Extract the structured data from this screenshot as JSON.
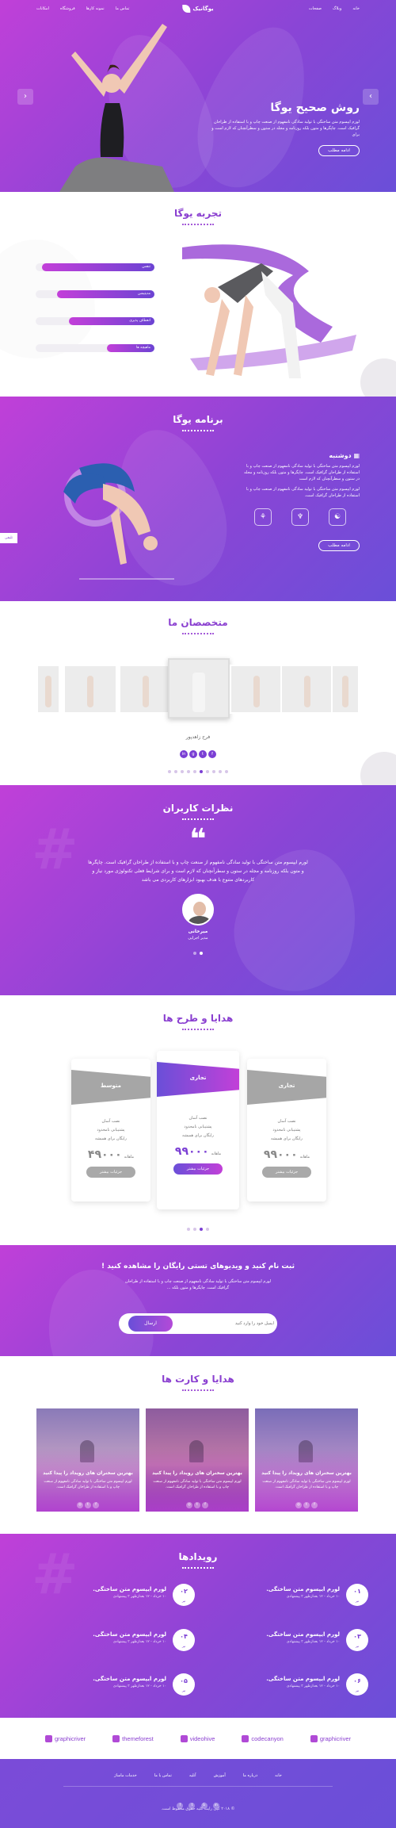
{
  "nav": {
    "brand": "یوگانیک",
    "right_menu": [
      "خانه",
      "وبلاگ",
      "صفحات"
    ],
    "left_menu": [
      "تماس ما",
      "نمونه کارها",
      "فروشگاه",
      "امکانات"
    ]
  },
  "hero": {
    "title": "روش صحیح یوگا",
    "text": "لورم ایپسوم متن ساختگی با تولید سادگی نامفهوم از صنعت چاپ و با استفاده از طراحان گرافیک است. چاپگرها و متون بلکه روزنامه و مجله در ستون و سطرآنچنان که لازم است و برای",
    "button": "ادامه مطلب"
  },
  "experience": {
    "title": "تجربه یوگا",
    "skills": [
      {
        "label": "تنفس",
        "percent": 95
      },
      {
        "label": "مدیتیشن",
        "percent": 82
      },
      {
        "label": "انعطاف پذیری",
        "percent": 72
      },
      {
        "label": "ماهیچه ها",
        "percent": 40
      }
    ]
  },
  "program": {
    "title": "برنامه یوگا",
    "day": "دوشنبه",
    "text1": "لورم ایپسوم متن ساختگی با تولید سادگی نامفهوم از صنعت چاپ و با استفاده از طراحان گرافیک است. چاپگرها و متون بلکه روزنامه و مجله در ستون و سطرآنچنان که لازم است",
    "text2": "لورم ایپسوم متن ساختگی با تولید سادگی نامفهوم از صنعت چاپ و با استفاده از طراحان گرافیک است.",
    "button": "ادامه مطلب",
    "side_tab": "تلیفی"
  },
  "experts": {
    "title": "متخصصان ما",
    "name": "فرح زاهدپور",
    "social": [
      "f",
      "t",
      "g",
      "in"
    ],
    "pages": 10
  },
  "testimonial": {
    "title": "نظرات کاربران",
    "quote": "لورم ایپسوم متن ساختگی با تولید سادگی نامفهوم از صنعت چاپ و با استفاده از طراحان گرافیک است. چاپگرها و متون بلکه روزنامه و مجله در ستون و سطرآنچنان که لازم است و برای شرایط فعلی تکنولوژی مورد نیاز و کاربردهای متنوع با هدف بهبود ابزارهای کاربردی می باشد",
    "name": "میرخانی",
    "role": "مدیر اجرایی"
  },
  "pricing": {
    "title": "هدایا و طرح ها",
    "cards": [
      {
        "name": "تجاری",
        "features": [
          "نصب آسان",
          "پشتیبانی نامحدود",
          "رایگان برای همیشه"
        ],
        "price": "۹۹۰۰۰",
        "unit": "ماهانه",
        "button": "جزئیات بیشتر"
      },
      {
        "name": "تجاری",
        "features": [
          "نصب آسان",
          "پشتیبانی نامحدود",
          "رایگان برای همیشه"
        ],
        "price": "۹۹۰۰۰",
        "unit": "ماهانه",
        "button": "جزئیات بیشتر"
      },
      {
        "name": "متوسط",
        "features": [
          "نصب آسان",
          "پشتیبانی نامحدود",
          "رایگان برای همیشه"
        ],
        "price": "۴۹۰۰۰",
        "unit": "ماهانه",
        "button": "جزئیات بیشتر"
      }
    ],
    "pages": 4
  },
  "subscribe": {
    "title": "ثبت نام کنید و ویدیوهای تستی رایگان را مشاهده کنید !",
    "text": "لورم ایپسوم متن ساختگی با تولید سادگی نامفهوم از صنعت چاپ و با استفاده از طراحان گرافیک است. چاپگرها و متون بلکه ...",
    "placeholder": "ایمیل خود را وارد کنید",
    "button": "ارسال"
  },
  "gifts": {
    "title": "هدایا و کارت ها",
    "items": [
      {
        "title": "بهترین سخنران های رویداد را پیدا کنید",
        "text": "لورم ایپسوم متن ساختگی با تولید سادگی نامفهوم از صنعت چاپ و با استفاده از طراحان گرافیک است."
      },
      {
        "title": "بهترین سخنران های رویداد را پیدا کنید",
        "text": "لورم ایپسوم متن ساختگی با تولید سادگی نامفهوم از صنعت چاپ و با استفاده از طراحان گرافیک است."
      },
      {
        "title": "بهترین سخنران های رویداد را پیدا کنید",
        "text": "لورم ایپسوم متن ساختگی با تولید سادگی نامفهوم از صنعت چاپ و با استفاده از طراحان گرافیک است."
      }
    ]
  },
  "events": {
    "title": "رویدادها",
    "items": [
      {
        "num": "۰۱",
        "sub": "تیر",
        "title": "لورم ایپسوم متن ساختگی.",
        "meta": "۱۰ خرداد - ۱۲ بعدازظهر  ۳ پیشنهادی"
      },
      {
        "num": "۰۲",
        "sub": "تیر",
        "title": "لورم ایپسوم متن ساختگی.",
        "meta": "۱۰ خرداد - ۱۲ بعدازظهر  ۳ پیشنهادی"
      },
      {
        "num": "۰۳",
        "sub": "تیر",
        "title": "لورم ایپسوم متن ساختگی.",
        "meta": "۱۰ خرداد - ۱۲ بعدازظهر  ۳ پیشنهادی"
      },
      {
        "num": "۰۴",
        "sub": "تیر",
        "title": "لورم ایپسوم متن ساختگی.",
        "meta": "۱۰ خرداد - ۱۲ بعدازظهر  ۳ پیشنهادی"
      },
      {
        "num": "۰۶",
        "sub": "تیر",
        "title": "لورم ایپسوم متن ساختگی.",
        "meta": "۱۰ خرداد - ۱۲ بعدازظهر  ۳ پیشنهادی"
      },
      {
        "num": "۰۵",
        "sub": "تیر",
        "title": "لورم ایپسوم متن ساختگی.",
        "meta": "۱۰ خرداد - ۱۲ بعدازظهر  ۳ پیشنهادی"
      }
    ]
  },
  "brands": [
    "graphicriver",
    "themeforest",
    "videohive",
    "codecanyon",
    "graphicriver"
  ],
  "footer": {
    "links": [
      "خانه",
      "درباره ما",
      "آموزش",
      "آتلیه",
      "تماس با ما",
      "خدمات ماساژ"
    ],
    "social": [
      "f",
      "t",
      "G",
      "in"
    ],
    "copyright": "© ۲۰۱۸ کپی رایت کلیه حقوق محفوظ است."
  },
  "colors": {
    "purple": "#8a45d6",
    "pink": "#c040d8",
    "violet": "#6a4fd8"
  }
}
